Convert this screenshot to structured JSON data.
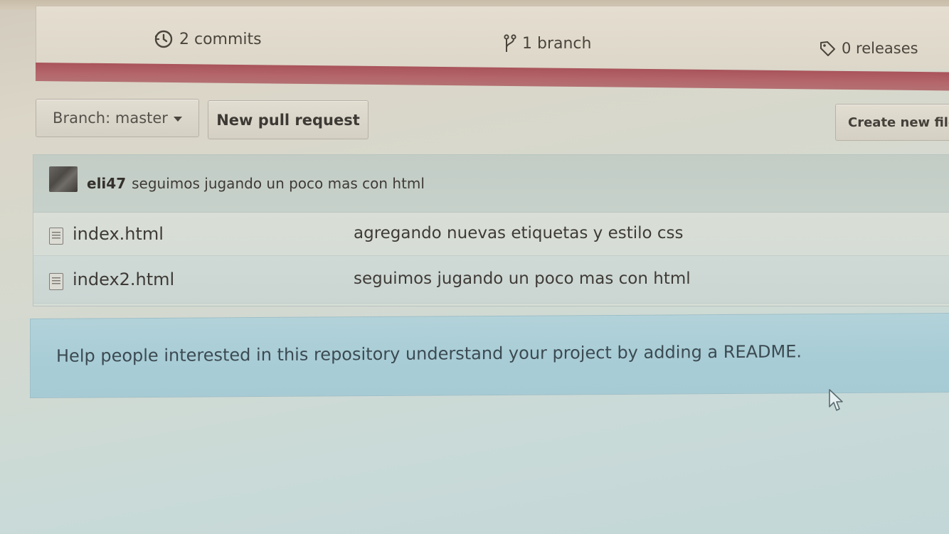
{
  "repo_summary": {
    "commits_label": "2 commits",
    "branches_label": "1 branch",
    "releases_label": "0 releases",
    "commits_icon": "history-icon",
    "branch_icon": "git-branch-icon",
    "releases_icon": "tag-icon"
  },
  "language_bar": {
    "color": "#b0585e"
  },
  "toolbar": {
    "branch_select_label": "Branch: master",
    "new_pull_request_label": "New pull request",
    "create_new_file_label": "Create new file"
  },
  "latest_commit": {
    "author": "eli47",
    "message": "seguimos jugando un poco mas con html"
  },
  "files": [
    {
      "name": "index.html",
      "last_commit_message": "agregando nuevas etiquetas y estilo css",
      "icon": "file-text-icon"
    },
    {
      "name": "index2.html",
      "last_commit_message": "seguimos jugando un poco mas con html",
      "icon": "file-text-icon"
    }
  ],
  "readme_prompt": {
    "text": "Help people interested in this repository understand your project by adding a README."
  }
}
